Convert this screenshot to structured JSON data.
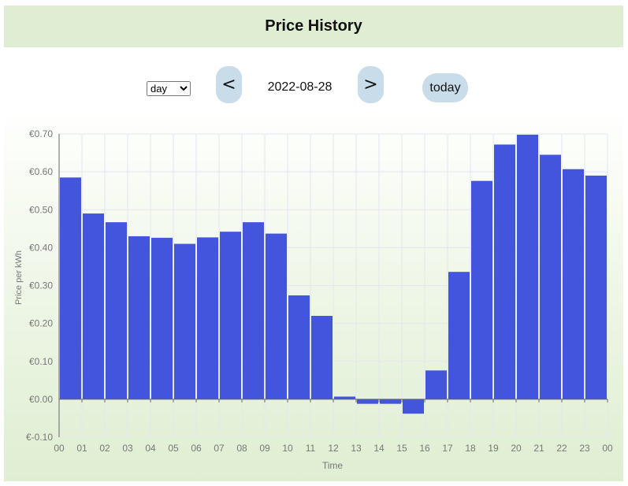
{
  "header": {
    "title": "Price History"
  },
  "controls": {
    "period_options": [
      "day"
    ],
    "period_selected": "day",
    "prev_label": "<",
    "next_label": ">",
    "date": "2022-08-28",
    "today_label": "today"
  },
  "chart_data": {
    "type": "bar",
    "title": "",
    "xlabel": "Time",
    "ylabel": "Price per kWh",
    "categories": [
      "00",
      "01",
      "02",
      "03",
      "04",
      "05",
      "06",
      "07",
      "08",
      "09",
      "10",
      "11",
      "12",
      "13",
      "14",
      "15",
      "16",
      "17",
      "18",
      "19",
      "20",
      "21",
      "22",
      "23"
    ],
    "x_tick_labels": [
      "00",
      "01",
      "02",
      "03",
      "04",
      "05",
      "06",
      "07",
      "08",
      "09",
      "10",
      "11",
      "12",
      "13",
      "14",
      "15",
      "16",
      "17",
      "18",
      "19",
      "20",
      "21",
      "22",
      "23",
      "00"
    ],
    "values": [
      0.585,
      0.49,
      0.467,
      0.43,
      0.426,
      0.41,
      0.427,
      0.442,
      0.467,
      0.437,
      0.274,
      0.22,
      0.007,
      -0.012,
      -0.012,
      -0.038,
      0.076,
      0.336,
      0.576,
      0.672,
      0.698,
      0.645,
      0.607,
      0.59
    ],
    "ylim": [
      -0.1,
      0.7
    ],
    "y_ticks": [
      -0.1,
      0.0,
      0.1,
      0.2,
      0.3,
      0.4,
      0.5,
      0.6,
      0.7
    ],
    "y_tick_labels": [
      "€-0.10",
      "€0.00",
      "€0.10",
      "€0.20",
      "€0.30",
      "€0.40",
      "€0.50",
      "€0.60",
      "€0.70"
    ],
    "grid": true,
    "bar_color": "#4455dd"
  }
}
